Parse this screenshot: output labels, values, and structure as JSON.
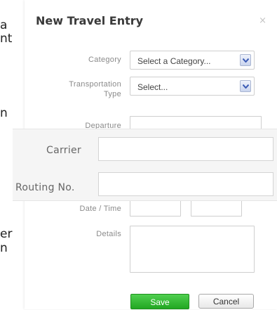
{
  "background": {
    "fragments": [
      "a",
      "nt",
      "n",
      "er",
      "n"
    ]
  },
  "modal": {
    "title": "New Travel Entry",
    "close_glyph": "×",
    "fields": {
      "category_label": "Category",
      "category_value": "Select a Category...",
      "transport_label_line1": "Transportation",
      "transport_label_line2": "Type",
      "transport_value": "Select...",
      "departure_label": "Departure",
      "datetime_label": "Date / Time",
      "details_label": "Details"
    },
    "overlay": {
      "carrier_label": "Carrier",
      "routing_label": "Routing No."
    },
    "buttons": {
      "save": "Save",
      "cancel": "Cancel"
    },
    "colors": {
      "save_green": "#2eb82e",
      "select_arrow_blue": "#3b5bb5"
    }
  }
}
